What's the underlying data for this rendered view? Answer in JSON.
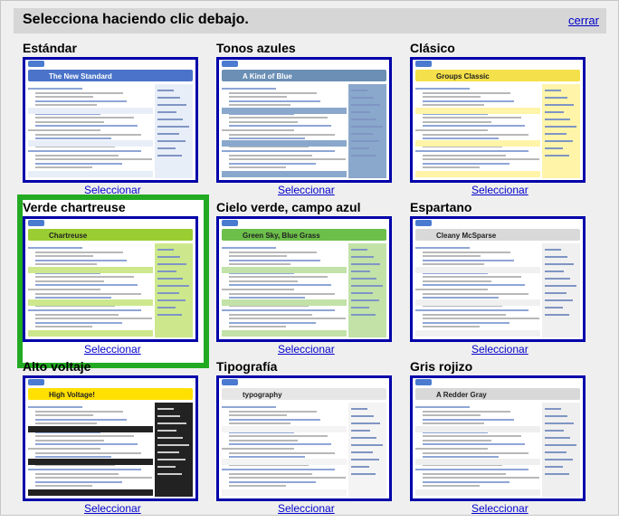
{
  "dialog": {
    "title": "Selecciona haciendo clic debajo.",
    "close_label": "cerrar"
  },
  "themes": [
    {
      "name": "Estándar",
      "banner": "The New Standard",
      "bar": "#4a73c9",
      "side": "#e8eef8",
      "selected": false
    },
    {
      "name": "Tonos azules",
      "banner": "A Kind of Blue",
      "bar": "#6b8fb5",
      "side": "#8aa8cc",
      "selected": false
    },
    {
      "name": "Clásico",
      "banner": "Groups Classic",
      "bar": "#f4e04a",
      "side": "#fff4a8",
      "selected": false
    },
    {
      "name": "Verde chartreuse",
      "banner": "Chartreuse",
      "bar": "#9acd32",
      "side": "#cde88c",
      "selected": true
    },
    {
      "name": "Cielo verde, campo azul",
      "banner": "Green Sky, Blue Grass",
      "bar": "#6cbf4a",
      "side": "#c2e2a8",
      "selected": false
    },
    {
      "name": "Espartano",
      "banner": "Cleany McSparse",
      "bar": "#d9d9d9",
      "side": "#f0f0f0",
      "selected": false
    },
    {
      "name": "Alto voltaje",
      "banner": "High Voltage!",
      "bar": "#ffe000",
      "side": "#222222",
      "selected": false
    },
    {
      "name": "Tipografía",
      "banner": "typography",
      "bar": "#e6e6e6",
      "side": "#f4f4f4",
      "selected": false
    },
    {
      "name": "Gris rojizo",
      "banner": "A Redder Gray",
      "bar": "#d8d8d8",
      "side": "#efefef",
      "selected": false
    }
  ],
  "select_label": "Seleccionar"
}
